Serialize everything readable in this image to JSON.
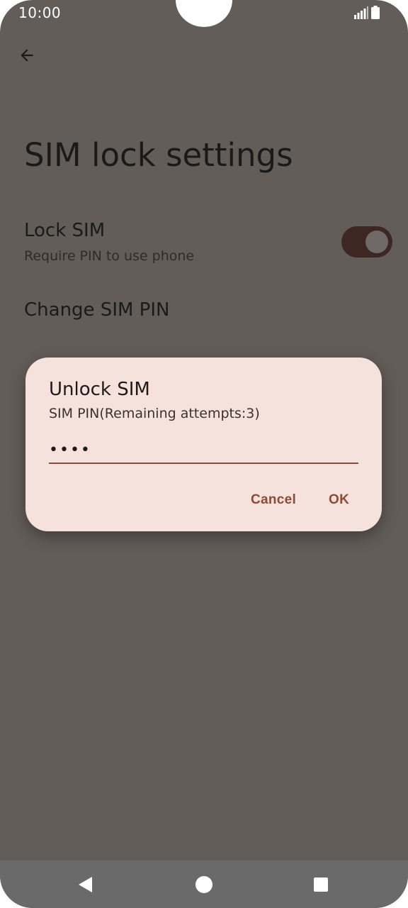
{
  "status_bar": {
    "time": "10:00",
    "icons": [
      "signal-icon",
      "battery-icon"
    ]
  },
  "toolbar": {
    "back_icon": "arrow-back-icon"
  },
  "page": {
    "title": "SIM lock settings"
  },
  "settings": {
    "lock_sim": {
      "title": "Lock SIM",
      "summary": "Require PIN to use phone",
      "enabled": true
    },
    "change_pin": {
      "title": "Change SIM PIN"
    }
  },
  "dialog": {
    "title": "Unlock SIM",
    "subtitle": "SIM PIN(Remaining attempts:3)",
    "pin_value": "••••",
    "cancel_label": "Cancel",
    "ok_label": "OK"
  },
  "colors": {
    "scrim_background": "#635d59",
    "dialog_background": "#f6e2dd",
    "accent": "#8d4a35",
    "toggle_track": "#3e2723"
  },
  "navbar": {
    "icons": [
      "nav-back-icon",
      "nav-home-icon",
      "nav-recents-icon"
    ]
  }
}
